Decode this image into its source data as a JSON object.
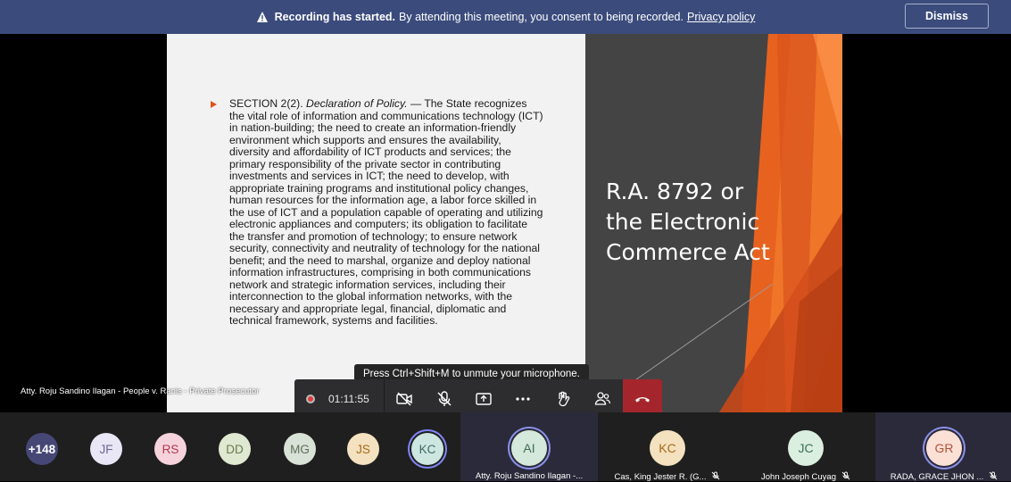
{
  "banner": {
    "bold_text": "Recording has started.",
    "text": "By attending this meeting, you consent to being recorded.",
    "link": "Privacy policy",
    "dismiss_label": "Dismiss"
  },
  "slide": {
    "section_heading": "SECTION 2(2). ",
    "section_title": "Declaration of Policy.",
    "section_body": " — The State recognizes the vital role of information and communications technology (ICT) in nation-building; the need to create an information-friendly environment which supports and ensures the availability, diversity and affordability of ICT products and services; the primary responsibility of the private sector in contributing investments and services in ICT; the need to develop, with appropriate training programs and institutional policy changes, human resources for the information age, a labor force skilled in the use of ICT and a population capable of operating and utilizing electronic appliances and computers; its obligation to facilitate the transfer and promotion of technology; to ensure network security, connectivity and neutrality of technology for the national benefit; and the need to marshal, organize and deploy national information infrastructures, comprising in both communications network and strategic information services, including their interconnection to the global information networks, with the necessary and appropriate legal, financial, diplomatic and technical framework, systems and facilities.",
    "title": "R.A. 8792 or\nthe Electronic\nCommerce Act",
    "accent_color": "#e0521d"
  },
  "speaker_label": "Atty. Roju Sandino Ilagan - People v. Ranis - Private Prosecutor",
  "tooltip": "Press Ctrl+Shift+M to unmute your microphone.",
  "controls": {
    "timer": "01:11:55",
    "icons": [
      "record-icon",
      "camera-off-icon",
      "mic-off-icon",
      "share-icon",
      "more-icon",
      "raise-hand-icon",
      "participants-icon",
      "hang-up-icon"
    ]
  },
  "participants": {
    "overflow": "+148",
    "mini": [
      {
        "initials": "JF",
        "bg": "#e9e6f5",
        "fg": "#6b6894"
      },
      {
        "initials": "RS",
        "bg": "#f6d3dc",
        "fg": "#b0384f"
      },
      {
        "initials": "DD",
        "bg": "#dfe8d0",
        "fg": "#6a7b4e"
      },
      {
        "initials": "MG",
        "bg": "#d9e2d6",
        "fg": "#5d6f5a"
      },
      {
        "initials": "JS",
        "bg": "#f4e1bf",
        "fg": "#a26a1c"
      },
      {
        "initials": "KC",
        "bg": "#cde6e0",
        "fg": "#3f6a60"
      }
    ],
    "tiles": [
      {
        "initials": "AI",
        "name": "Atty. Roju Sandino Ilagan -...",
        "bg": "#d5e8dc",
        "fg": "#3d6b4f"
      },
      {
        "initials": "KC",
        "name": "Cas, King Jester R. (G...",
        "bg": "#f4e1bf",
        "fg": "#a26a1c"
      },
      {
        "initials": "JC",
        "name": "John Joseph Cuyag",
        "bg": "#dbefe0",
        "fg": "#3c7150"
      },
      {
        "initials": "GR",
        "name": "RADA, GRACE JHON ...",
        "bg": "#fbe0d6",
        "fg": "#b1533a"
      }
    ]
  }
}
